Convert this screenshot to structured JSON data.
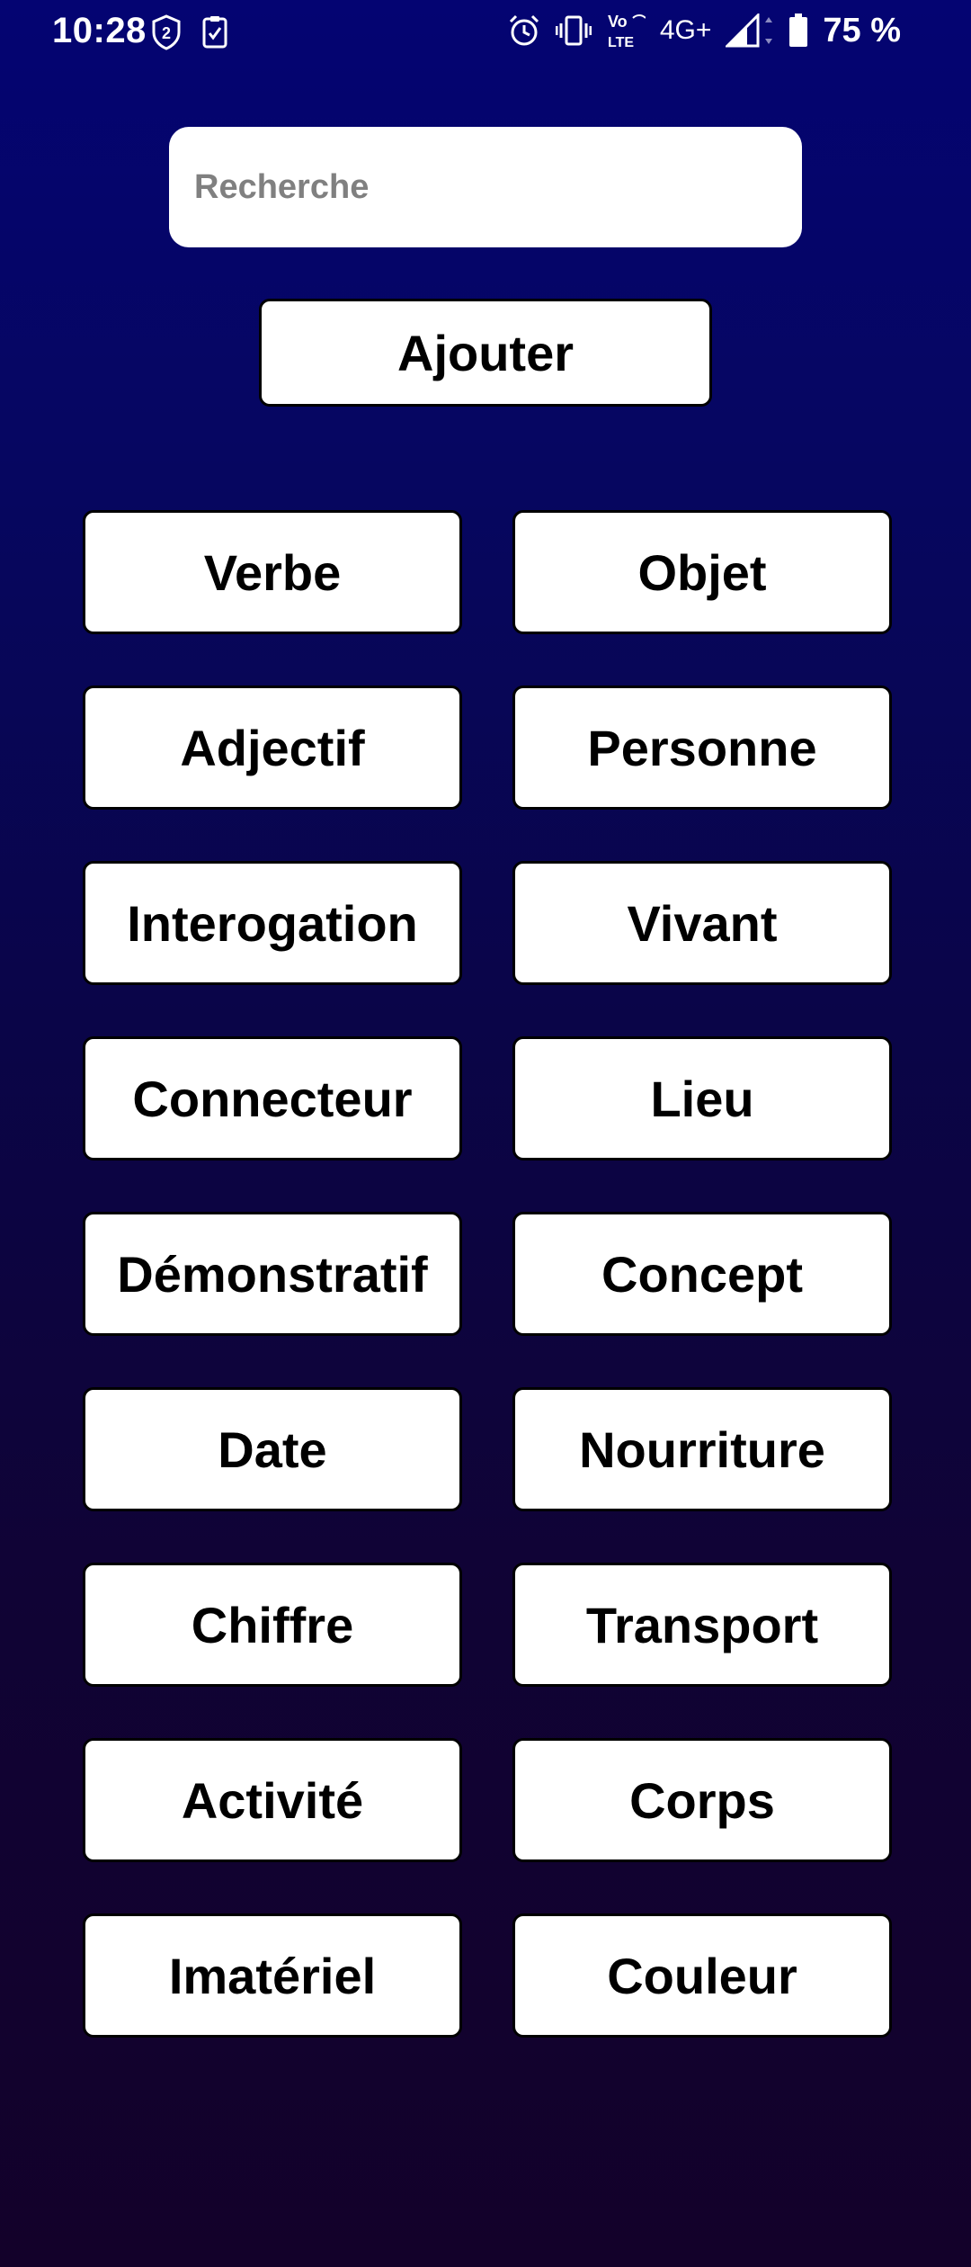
{
  "status_bar": {
    "time": "10:28",
    "network": "4G+",
    "battery": "75 %"
  },
  "search": {
    "placeholder": "Recherche",
    "value": ""
  },
  "add_button": {
    "label": "Ajouter"
  },
  "categories": [
    "Verbe",
    "Objet",
    "Adjectif",
    "Personne",
    "Interogation",
    "Vivant",
    "Connecteur",
    "Lieu",
    "Démonstratif",
    "Concept",
    "Date",
    "Nourriture",
    "Chiffre",
    "Transport",
    "Activité",
    "Corps",
    "Imatériel",
    "Couleur"
  ],
  "icons": {
    "badge": "shield-badge-icon",
    "task": "clipboard-check-icon",
    "alarm": "alarm-icon",
    "vibrate": "vibrate-icon",
    "volte": "volte-icon",
    "signal": "signal-icon",
    "battery": "battery-icon"
  }
}
